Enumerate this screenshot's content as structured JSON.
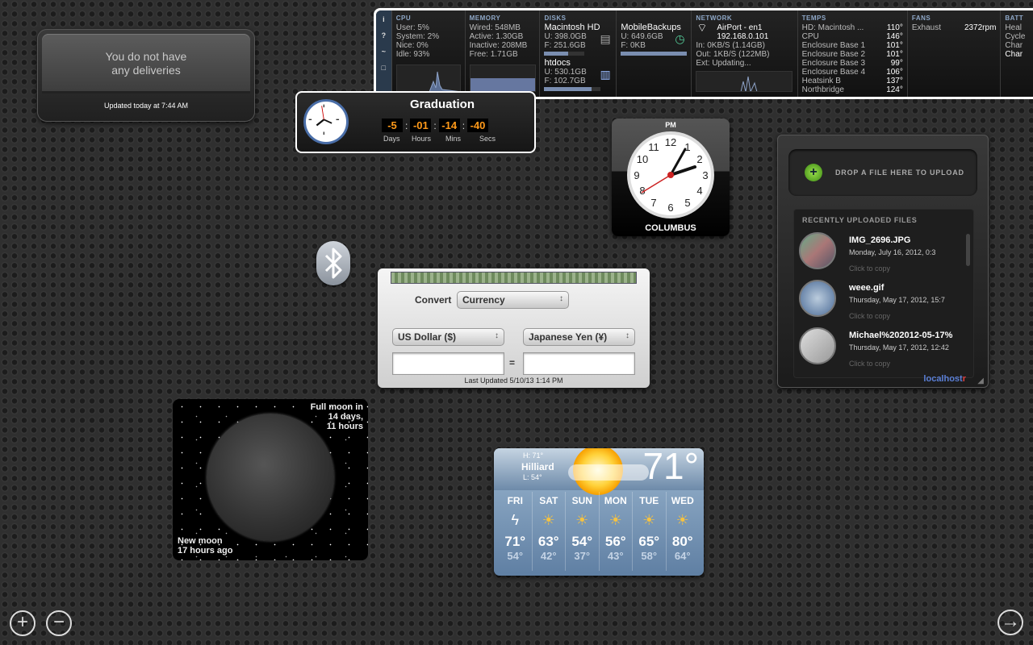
{
  "deliveries": {
    "message_line1": "You do not have",
    "message_line2": "any deliveries",
    "updated": "Updated today at 7:44 AM"
  },
  "istat": {
    "tabs": [
      "i",
      "?",
      "~",
      "□"
    ],
    "cpu": {
      "title": "CPU",
      "user": "User: 5%",
      "system": "System: 2%",
      "nice": "Nice: 0%",
      "idle": "Idle: 93%"
    },
    "memory": {
      "title": "MEMORY",
      "wired": "Wired: 548MB",
      "active": "Active: 1.30GB",
      "inactive": "Inactive: 208MB",
      "free": "Free: 1.71GB"
    },
    "disks": {
      "title": "DISKS",
      "d1_name": "Macintosh HD",
      "d1_used": "U: 398.0GB",
      "d1_free": "F: 251.6GB",
      "d2_name": "htdocs",
      "d2_used": "U: 530.1GB",
      "d2_free": "F: 102.7GB"
    },
    "backups": {
      "name": "MobileBackups",
      "used": "U: 649.6GB",
      "free": "F: 0KB"
    },
    "network": {
      "title": "NETWORK",
      "iface": "AirPort - en1",
      "ip": "192.168.0.101",
      "in": "In: 0KB/S (1.14GB)",
      "out": "Out: 1KB/S (122MB)",
      "ext": "Ext: Updating..."
    },
    "temps": {
      "title": "TEMPS",
      "rows": [
        {
          "label": "HD: Macintosh ...",
          "value": "110°"
        },
        {
          "label": "CPU",
          "value": "146°"
        },
        {
          "label": "Enclosure Base 1",
          "value": "101°"
        },
        {
          "label": "Enclosure Base 2",
          "value": "101°"
        },
        {
          "label": "Enclosure Base 3",
          "value": "99°"
        },
        {
          "label": "Enclosure Base 4",
          "value": "106°"
        },
        {
          "label": "Heatsink B",
          "value": "137°"
        },
        {
          "label": "Northbridge",
          "value": "124°"
        }
      ]
    },
    "fans": {
      "title": "FANS",
      "label": "Exhaust",
      "value": "2372rpm"
    },
    "battery": {
      "title": "BATT",
      "l1": "Heal",
      "l2": "Cycle",
      "l3": "Char",
      "l4": "Char"
    }
  },
  "graduation": {
    "title": "Graduation",
    "days": "-5",
    "hours": "-01",
    "mins": "-14",
    "secs": "-40",
    "l_days": "Days",
    "l_hours": "Hours",
    "l_mins": "Mins",
    "l_secs": "Secs"
  },
  "world_clock": {
    "ampm": "PM",
    "city": "COLUMBUS"
  },
  "localhostr": {
    "drop_text": "DROP A FILE HERE TO UPLOAD",
    "recent_title": "RECENTLY UPLOADED FILES",
    "files": [
      {
        "name": "IMG_2696.JPG",
        "date": "Monday, July 16, 2012, 0:3",
        "action": "Click to copy"
      },
      {
        "name": "weee.gif",
        "date": "Thursday, May 17, 2012, 15:7",
        "action": "Click to copy"
      },
      {
        "name": "Michael%202012-05-17%",
        "date": "Thursday, May 17, 2012, 12:42",
        "action": "Click to copy"
      }
    ],
    "brand_a": "localhost",
    "brand_b": "r"
  },
  "currency": {
    "convert_label": "Convert",
    "mode": "Currency",
    "from": "US Dollar ($)",
    "to": "Japanese Yen (¥)",
    "eq": "=",
    "last_updated": "Last Updated 5/10/13 1:14 PM"
  },
  "moon": {
    "next_l1": "Full moon in",
    "next_l2": "14 days,",
    "next_l3": "11 hours",
    "prev_l1": "New moon",
    "prev_l2": "17 hours ago"
  },
  "weather": {
    "high": "H: 71°",
    "city": "Hilliard",
    "low": "L: 54°",
    "temp": "71°",
    "days": [
      {
        "name": "FRI",
        "hi": "71°",
        "lo": "54°",
        "icon": "lightning-icon"
      },
      {
        "name": "SAT",
        "hi": "63°",
        "lo": "42°",
        "icon": "sun-rain-icon"
      },
      {
        "name": "SUN",
        "hi": "54°",
        "lo": "37°",
        "icon": "sun-cloud-icon"
      },
      {
        "name": "MON",
        "hi": "56°",
        "lo": "43°",
        "icon": "sun-cloud-icon"
      },
      {
        "name": "TUE",
        "hi": "65°",
        "lo": "58°",
        "icon": "sun-cloud-icon"
      },
      {
        "name": "WED",
        "hi": "80°",
        "lo": "64°",
        "icon": "sun-cloud-icon"
      }
    ]
  },
  "dock": {
    "add": "+",
    "remove": "−",
    "next": "→"
  }
}
